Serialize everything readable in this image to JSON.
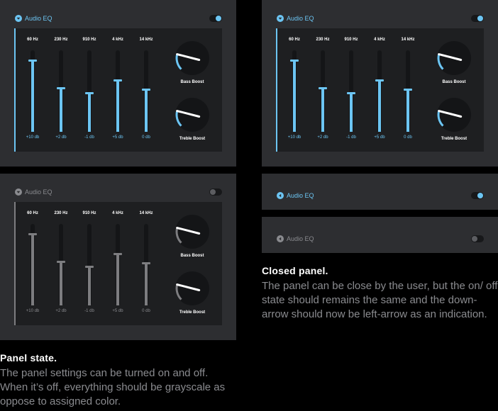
{
  "colors": {
    "accent": "#6cc5f3",
    "panel_bg": "#2d2e31",
    "eq_bg": "#1e1f21",
    "gray_line": "#7d7d80",
    "gray_text": "#8a8b8f",
    "page_bg": "#000000"
  },
  "panels": [
    {
      "title": "Audio EQ",
      "state": "on",
      "icon": "down-arrow-icon",
      "toggle_on": true,
      "bands": [
        {
          "freq": "60 Hz",
          "value": "+10 db",
          "level": 0.87
        },
        {
          "freq": "230 Hz",
          "value": "+2 db",
          "level": 0.53
        },
        {
          "freq": "910 Hz",
          "value": "-1 db",
          "level": 0.47
        },
        {
          "freq": "4 kHz",
          "value": "+5 db",
          "level": 0.63
        },
        {
          "freq": "14 kHz",
          "value": "0 db",
          "level": 0.51
        }
      ],
      "bass_boost": {
        "label": "Bass Boost",
        "level": 0.22
      },
      "treble_boost": {
        "label": "Treble Boost",
        "level": 0.22
      }
    },
    {
      "title": "Audio EQ",
      "state": "on",
      "icon": "down-arrow-icon",
      "toggle_on": true,
      "bands": [
        {
          "freq": "60 Hz",
          "value": "+10 db",
          "level": 0.87
        },
        {
          "freq": "230 Hz",
          "value": "+2 db",
          "level": 0.53
        },
        {
          "freq": "910 Hz",
          "value": "-1 db",
          "level": 0.47
        },
        {
          "freq": "4 kHz",
          "value": "+5 db",
          "level": 0.63
        },
        {
          "freq": "14 kHz",
          "value": "0 db",
          "level": 0.51
        }
      ],
      "bass_boost": {
        "label": "Bass Boost",
        "level": 0.22
      },
      "treble_boost": {
        "label": "Treble Boost",
        "level": 0.22
      }
    },
    {
      "title": "Audio EQ",
      "state": "off",
      "icon": "down-arrow-icon",
      "toggle_on": false,
      "bands": [
        {
          "freq": "60 Hz",
          "value": "+10 db",
          "level": 0.87
        },
        {
          "freq": "230 Hz",
          "value": "+2 db",
          "level": 0.53
        },
        {
          "freq": "910 Hz",
          "value": "-1 db",
          "level": 0.47
        },
        {
          "freq": "4 kHz",
          "value": "+5 db",
          "level": 0.63
        },
        {
          "freq": "14 kHz",
          "value": "0 db",
          "level": 0.51
        }
      ],
      "bass_boost": {
        "label": "Bass Boost",
        "level": 0.22
      },
      "treble_boost": {
        "label": "Treble Boost",
        "level": 0.22
      }
    }
  ],
  "closed_panels": [
    {
      "title": "Audio EQ",
      "icon": "left-arrow-icon",
      "toggle_on": true
    },
    {
      "title": "Audio EQ",
      "icon": "left-arrow-icon",
      "toggle_on": false
    }
  ],
  "captions": {
    "closed": {
      "title": "Closed panel.",
      "desc": "The panel can be close by the user, but the on/ off state should remains the same and the down-arrow should now be left-arrow as an indication."
    },
    "state": {
      "title": "Panel state.",
      "desc": "The panel settings can be turned on and off. When it’s off, everything should be grayscale as oppose to assigned color."
    }
  }
}
